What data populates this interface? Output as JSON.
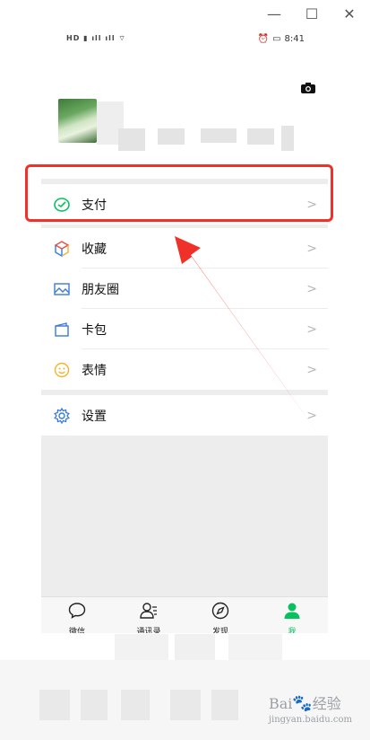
{
  "window": {
    "minimize_glyph": "—",
    "maximize_glyph": "☐",
    "close_glyph": "✕"
  },
  "statusbar": {
    "left_text": "HD",
    "time": "8:41"
  },
  "menu": {
    "pay": {
      "label": "支付",
      "icon": "wechat-pay-icon"
    },
    "favorites": {
      "label": "收藏",
      "icon": "favorites-cube-icon"
    },
    "moments": {
      "label": "朋友圈",
      "icon": "moments-image-icon"
    },
    "cards": {
      "label": "卡包",
      "icon": "card-wallet-icon"
    },
    "stickers": {
      "label": "表情",
      "icon": "smiley-icon"
    },
    "settings": {
      "label": "设置",
      "icon": "gear-icon"
    }
  },
  "tabs": [
    {
      "label": "微信",
      "icon": "chat-bubble-icon"
    },
    {
      "label": "通讯录",
      "icon": "contacts-icon"
    },
    {
      "label": "发现",
      "icon": "compass-icon"
    },
    {
      "label": "我",
      "icon": "person-icon"
    }
  ],
  "colors": {
    "accent": "#07c160",
    "highlight": "#f0312a",
    "arrow": "#f0312a"
  },
  "watermark": {
    "text": "Bai",
    "suffix": "经验",
    "domain": "jingyan.baidu.com"
  }
}
